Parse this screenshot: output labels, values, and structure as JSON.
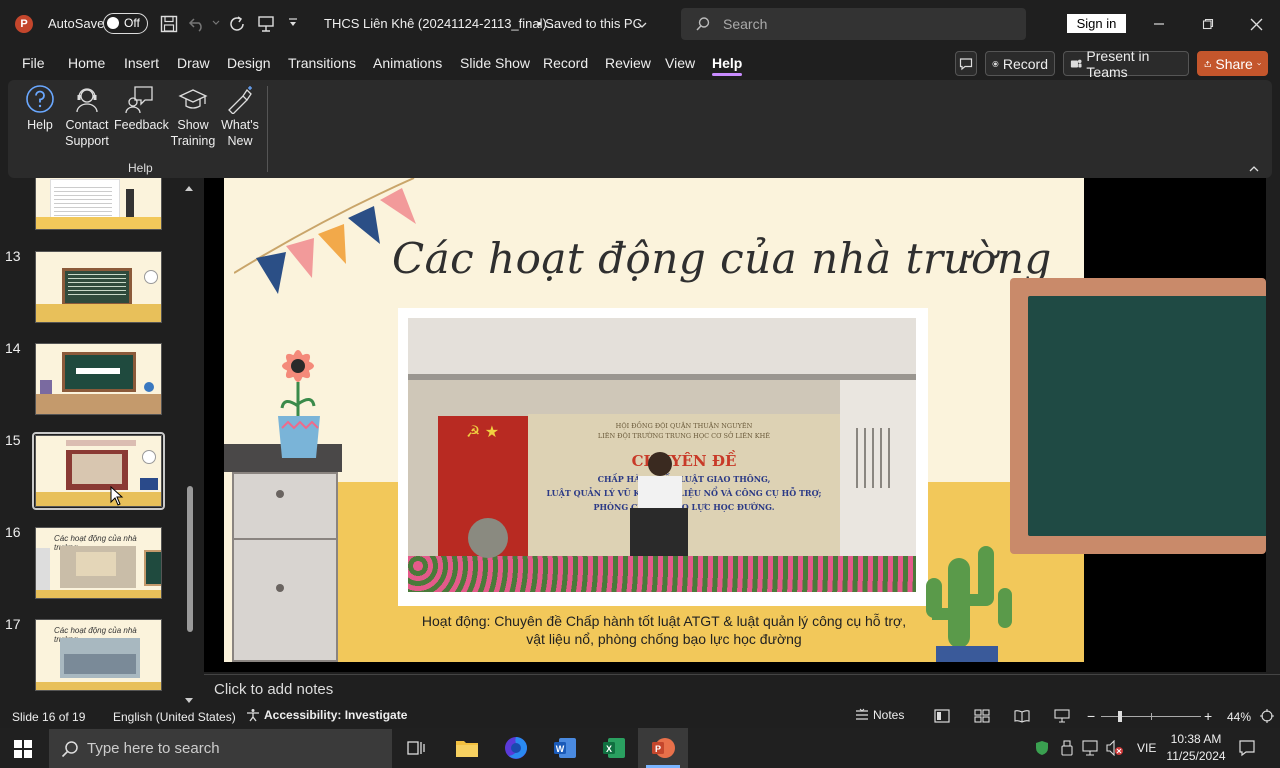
{
  "titlebar": {
    "autosave_label": "AutoSave",
    "autosave_state": "Off",
    "doc_title": "THCS Liên Khê (20241124-2113_final)....",
    "save_status": "• Saved to this PC",
    "search_placeholder": "Search",
    "signin_label": "Sign in"
  },
  "menu": {
    "tabs": [
      "File",
      "Home",
      "Insert",
      "Draw",
      "Design",
      "Transitions",
      "Animations",
      "Slide Show",
      "Record",
      "Review",
      "View",
      "Help"
    ],
    "active_tab": "Help",
    "record_btn": "Record",
    "teams_btn": "Present in Teams",
    "share_btn": "Share"
  },
  "ribbon": {
    "items": [
      {
        "label": "Help",
        "icon": "help-icon"
      },
      {
        "label": "Contact Support",
        "line1": "Contact",
        "line2": "Support",
        "icon": "headset-icon"
      },
      {
        "label": "Feedback",
        "icon": "feedback-icon"
      },
      {
        "label": "Show Training",
        "line1": "Show",
        "line2": "Training",
        "icon": "graduation-cap-icon"
      },
      {
        "label": "What's New",
        "line1": "What's",
        "line2": "New",
        "icon": "wand-icon"
      }
    ],
    "group_label": "Help"
  },
  "thumbnails": [
    {
      "num": "13"
    },
    {
      "num": "14"
    },
    {
      "num": "15"
    },
    {
      "num": "16"
    },
    {
      "num": "17"
    }
  ],
  "slide": {
    "title": "Các hoạt động của nhà trường",
    "caption_line1": "Hoạt động: Chuyên đề Chấp hành tốt luật ATGT & luật quản lý công cụ hỗ trợ,",
    "caption_line2": "vật liệu nổ, phòng chống bạo lực học đường",
    "banner_line1": "HỘI ĐỒNG ĐỘI QUẬN THUẬN NGUYÊN",
    "banner_line2": "LIÊN ĐỘI TRƯỜNG TRUNG HỌC CƠ SỞ LIÊN KHÊ",
    "banner_heading": "CHUYÊN ĐỀ",
    "banner_text1": "CHẤP HÀNH TỐT LUẬT GIAO THÔNG,",
    "banner_text2": "LUẬT QUẢN LÝ VŨ KHÍ, VẬT LIỆU NỔ VÀ CÔNG CỤ HỖ TRỢ;",
    "banner_text3": "PHÒNG CHỐNG BẠO LỰC HỌC ĐƯỜNG."
  },
  "notes_placeholder": "Click to add notes",
  "statusbar": {
    "slide_info": "Slide 16 of 19",
    "language": "English (United States)",
    "accessibility": "Accessibility: Investigate",
    "notes_label": "Notes",
    "zoom": "44%"
  },
  "taskbar": {
    "search_placeholder": "Type here to search",
    "lang": "VIE",
    "time": "10:38 AM",
    "date": "11/25/2024"
  },
  "colors": {
    "accent_purple": "#c98cff",
    "share_orange": "#c4562c",
    "slide_bg": "#fbf3dc"
  }
}
